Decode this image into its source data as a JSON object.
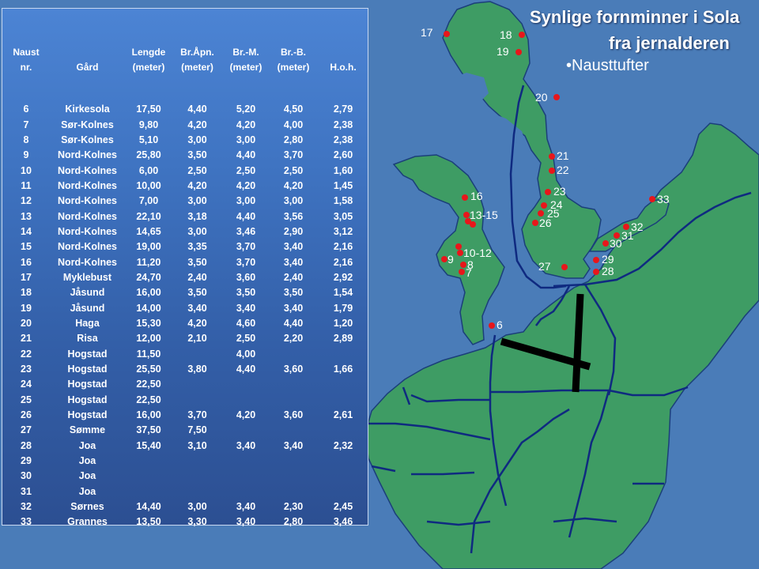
{
  "title_line1": "Synlige fornminner i Sola",
  "title_line2": "fra jernalderen",
  "subtitle": "•Nausttufter",
  "table": {
    "headers": [
      [
        "Naust",
        "nr."
      ],
      [
        "",
        "Gård"
      ],
      [
        "Lengde",
        "(meter)"
      ],
      [
        "Br.Åpn.",
        "(meter)"
      ],
      [
        "Br.-M.",
        "(meter)"
      ],
      [
        "Br.-B.",
        "(meter)"
      ],
      [
        "",
        "H.o.h."
      ]
    ],
    "rows": [
      [
        "6",
        "Kirkesola",
        "17,50",
        "4,40",
        "5,20",
        "4,50",
        "2,79"
      ],
      [
        "7",
        "Sør-Kolnes",
        "9,80",
        "4,20",
        "4,20",
        "4,00",
        "2,38"
      ],
      [
        "8",
        "Sør-Kolnes",
        "5,10",
        "3,00",
        "3,00",
        "2,80",
        "2,38"
      ],
      [
        "9",
        "Nord-Kolnes",
        "25,80",
        "3,50",
        "4,40",
        "3,70",
        "2,60"
      ],
      [
        "10",
        "Nord-Kolnes",
        "6,00",
        "2,50",
        "2,50",
        "2,50",
        "1,60"
      ],
      [
        "11",
        "Nord-Kolnes",
        "10,00",
        "4,20",
        "4,20",
        "4,20",
        "1,45"
      ],
      [
        "12",
        "Nord-Kolnes",
        "7,00",
        "3,00",
        "3,00",
        "3,00",
        "1,58"
      ],
      [
        "13",
        "Nord-Kolnes",
        "22,10",
        "3,18",
        "4,40",
        "3,56",
        "3,05"
      ],
      [
        "14",
        "Nord-Kolnes",
        "14,65",
        "3,00",
        "3,46",
        "2,90",
        "3,12"
      ],
      [
        "15",
        "Nord-Kolnes",
        "19,00",
        "3,35",
        "3,70",
        "3,40",
        "2,16"
      ],
      [
        "16",
        "Nord-Kolnes",
        "11,20",
        "3,50",
        "3,70",
        "3,40",
        "2,16"
      ],
      [
        "17",
        "Myklebust",
        "24,70",
        "2,40",
        "3,60",
        "2,40",
        "2,92"
      ],
      [
        "18",
        "Jåsund",
        "16,00",
        "3,50",
        "3,50",
        "3,50",
        "1,54"
      ],
      [
        "19",
        "Jåsund",
        "14,00",
        "3,40",
        "3,40",
        "3,40",
        "1,79"
      ],
      [
        "20",
        "Haga",
        "15,30",
        "4,20",
        "4,60",
        "4,40",
        "1,20"
      ],
      [
        "21",
        "Risa",
        "12,00",
        "2,10",
        "2,50",
        "2,20",
        "2,89"
      ],
      [
        "22",
        "Hogstad",
        "11,50",
        "",
        "4,00",
        "",
        ""
      ],
      [
        "23",
        "Hogstad",
        "25,50",
        "3,80",
        "4,40",
        "3,60",
        "1,66"
      ],
      [
        "24",
        "Hogstad",
        "22,50",
        "",
        "",
        "",
        ""
      ],
      [
        "25",
        "Hogstad",
        "22,50",
        "",
        "",
        "",
        ""
      ],
      [
        "26",
        "Hogstad",
        "16,00",
        "3,70",
        "4,20",
        "3,60",
        "2,61"
      ],
      [
        "27",
        "Sømme",
        "37,50",
        "7,50",
        "",
        "",
        ""
      ],
      [
        "28",
        "Joa",
        "15,40",
        "3,10",
        "3,40",
        "3,40",
        "2,32"
      ],
      [
        "29",
        "Joa",
        "",
        "",
        "",
        "",
        ""
      ],
      [
        "30",
        "Joa",
        "",
        "",
        "",
        "",
        ""
      ],
      [
        "31",
        "Joa",
        "",
        "",
        "",
        "",
        ""
      ],
      [
        "32",
        "Sørnes",
        "14,40",
        "3,00",
        "3,40",
        "2,30",
        "2,45"
      ],
      [
        "33",
        "Grannes",
        "13,50",
        "3,30",
        "3,40",
        "2,80",
        "3,46"
      ]
    ]
  },
  "map_labels": {
    "m6": "6",
    "m7": "7",
    "m8": "8",
    "m9": "9",
    "m10_12": "10-12",
    "m13_15": "13-15",
    "m16": "16",
    "m17": "17",
    "m18": "18",
    "m19": "19",
    "m20": "20",
    "m21": "21",
    "m22": "22",
    "m23": "23",
    "m24": "24",
    "m25": "25",
    "m26": "26",
    "m27": "27",
    "m28": "28",
    "m29": "29",
    "m30": "30",
    "m31": "31",
    "m32": "32",
    "m33": "33"
  },
  "colors": {
    "sea": "#4a7cb8",
    "land": "#3e9c64",
    "border": "#0f2a80",
    "marker": "#e8161b",
    "runway": "#000000"
  }
}
